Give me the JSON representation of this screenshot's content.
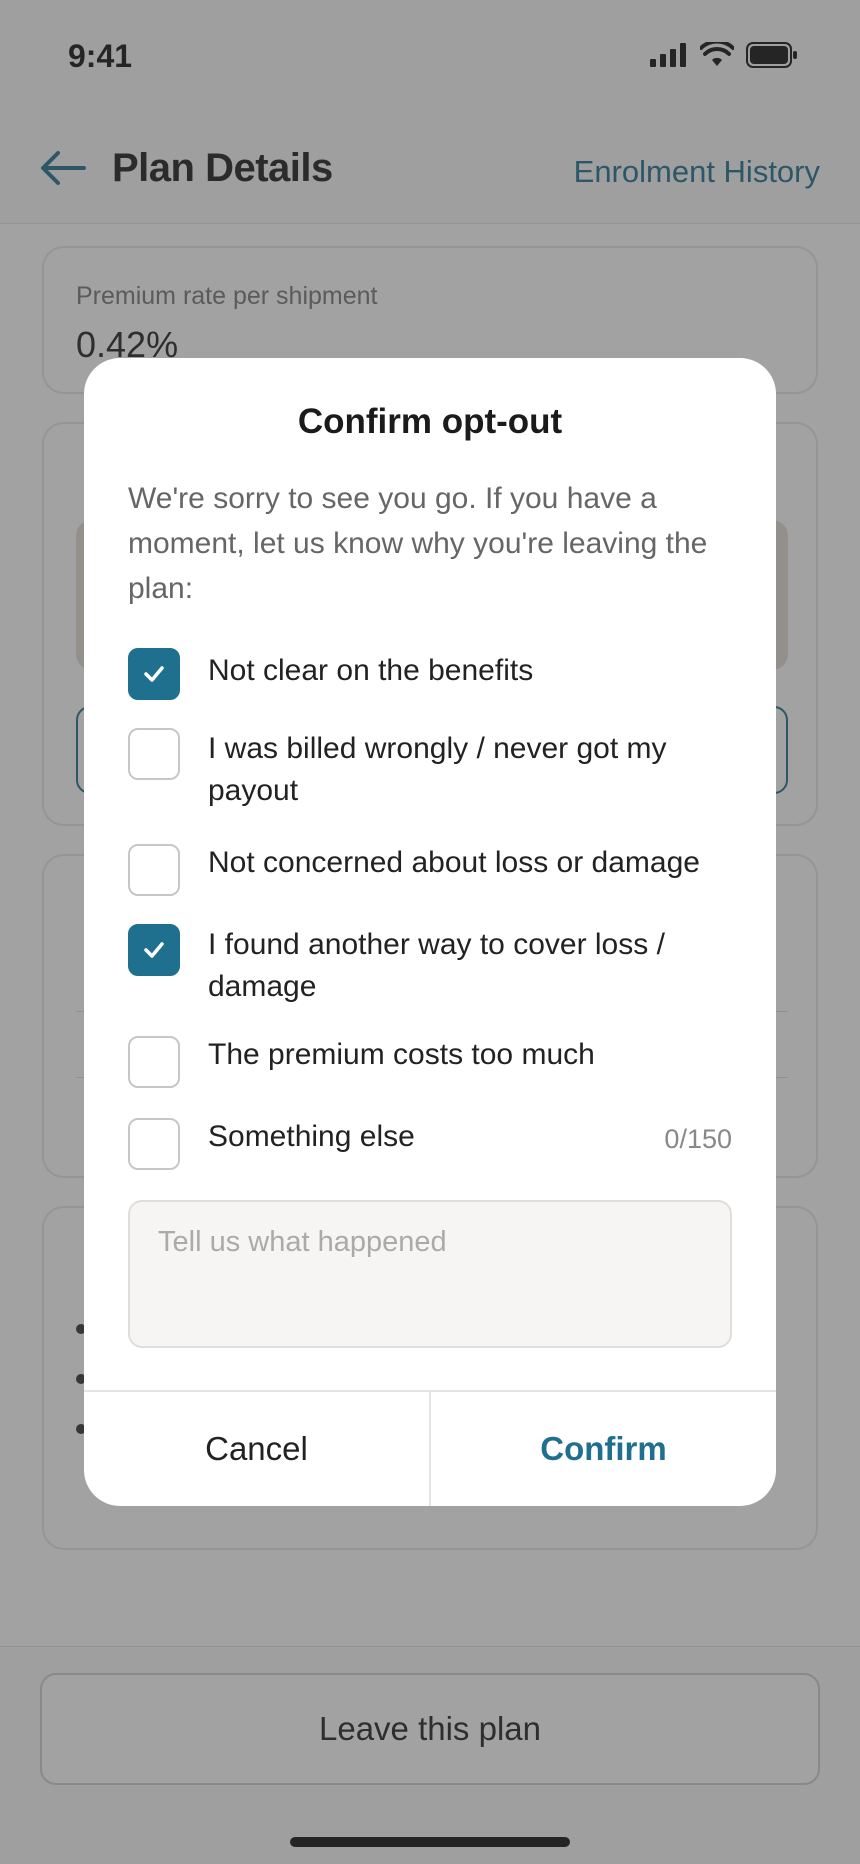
{
  "status_bar": {
    "time": "9:41"
  },
  "header": {
    "title": "Plan Details",
    "history_link": "Enrolment History"
  },
  "background": {
    "premium": {
      "label": "Premium rate per shipment",
      "value": "0.42%"
    },
    "leave_button": "Leave this plan"
  },
  "modal": {
    "title": "Confirm opt-out",
    "description": "We're sorry to see you go. If you have a moment, let us know why you're leaving the plan:",
    "options": [
      {
        "label": "Not clear on the benefits",
        "checked": true
      },
      {
        "label": "I was billed wrongly / never got my payout",
        "checked": false
      },
      {
        "label": "Not concerned about loss or damage",
        "checked": false
      },
      {
        "label": "I found another way to cover loss / damage",
        "checked": true
      },
      {
        "label": "The premium costs too much",
        "checked": false
      },
      {
        "label": "Something else",
        "checked": false
      }
    ],
    "counter": "0/150",
    "textarea_placeholder": "Tell us what happened",
    "cancel_label": "Cancel",
    "confirm_label": "Confirm"
  },
  "colors": {
    "accent": "#1f6f8f",
    "scrim": "#3c3c3c"
  }
}
